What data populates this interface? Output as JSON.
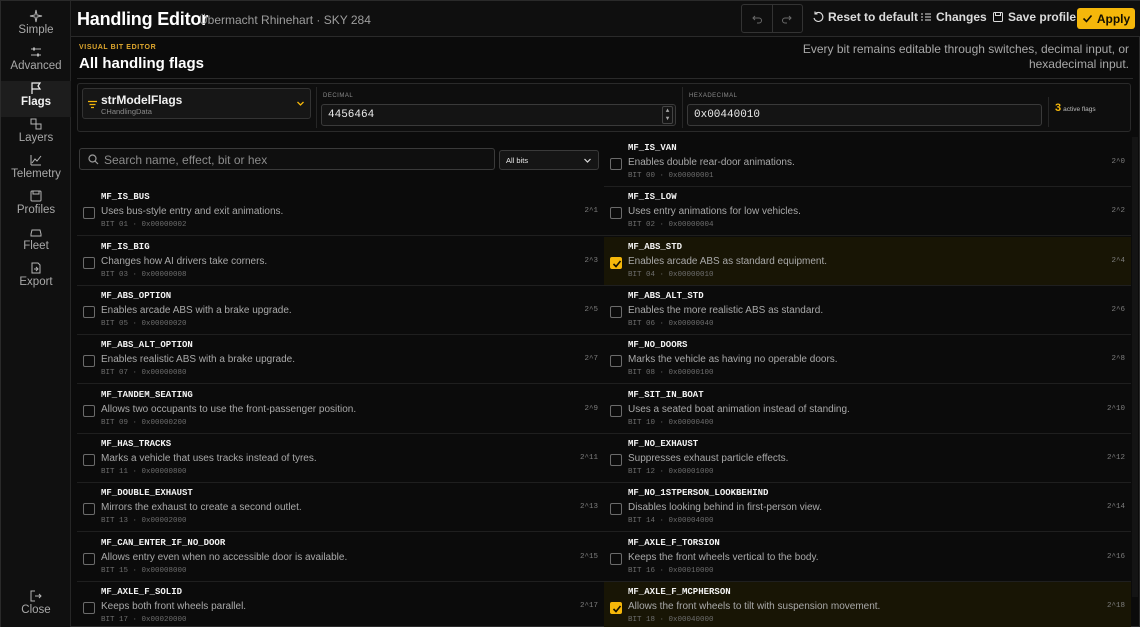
{
  "nav": {
    "items": [
      {
        "label": "Simple",
        "icon": "sparkle-icon"
      },
      {
        "label": "Advanced",
        "icon": "sliders-icon"
      },
      {
        "label": "Flags",
        "icon": "flag-icon"
      },
      {
        "label": "Layers",
        "icon": "layers-icon"
      },
      {
        "label": "Telemetry",
        "icon": "chart-icon"
      },
      {
        "label": "Profiles",
        "icon": "save-icon"
      },
      {
        "label": "Fleet",
        "icon": "car-icon"
      },
      {
        "label": "Export",
        "icon": "export-icon"
      }
    ],
    "active": "Flags",
    "close_label": "Close"
  },
  "header": {
    "title": "Handling Editor",
    "subtitle": "Übermacht Rhinehart · SKY 284",
    "reset_label": "Reset to default",
    "changes_label": "Changes",
    "save_label": "Save profile",
    "apply_label": "Apply"
  },
  "section": {
    "eyebrow": "VISUAL BIT EDITOR",
    "title": "All handling flags",
    "note": "Every bit remains editable through switches, decimal input, or hexadecimal input."
  },
  "controls": {
    "field_name": "strModelFlags",
    "field_class": "CHandlingData",
    "decimal_label": "DECIMAL",
    "decimal_value": "4456464",
    "hex_label": "HEXADECIMAL",
    "hex_value": "0x00440010",
    "active_count": "3",
    "active_label": "active flags"
  },
  "filter": {
    "search_placeholder": "Search name, effect, bit or hex",
    "bits_option": "All bits"
  },
  "flags": [
    {
      "name": "MF_IS_VAN",
      "desc": "Enables double rear-door animations.",
      "bit": "BIT 00 · 0x00000001",
      "pow": "2^0",
      "checked": false
    },
    {
      "name": "MF_IS_BUS",
      "desc": "Uses bus-style entry and exit animations.",
      "bit": "BIT 01 · 0x00000002",
      "pow": "2^1",
      "checked": false
    },
    {
      "name": "MF_IS_LOW",
      "desc": "Uses entry animations for low vehicles.",
      "bit": "BIT 02 · 0x00000004",
      "pow": "2^2",
      "checked": false
    },
    {
      "name": "MF_IS_BIG",
      "desc": "Changes how AI drivers take corners.",
      "bit": "BIT 03 · 0x00000008",
      "pow": "2^3",
      "checked": false
    },
    {
      "name": "MF_ABS_STD",
      "desc": "Enables arcade ABS as standard equipment.",
      "bit": "BIT 04 · 0x00000010",
      "pow": "2^4",
      "checked": true
    },
    {
      "name": "MF_ABS_OPTION",
      "desc": "Enables arcade ABS with a brake upgrade.",
      "bit": "BIT 05 · 0x00000020",
      "pow": "2^5",
      "checked": false
    },
    {
      "name": "MF_ABS_ALT_STD",
      "desc": "Enables the more realistic ABS as standard.",
      "bit": "BIT 06 · 0x00000040",
      "pow": "2^6",
      "checked": false
    },
    {
      "name": "MF_ABS_ALT_OPTION",
      "desc": "Enables realistic ABS with a brake upgrade.",
      "bit": "BIT 07 · 0x00000080",
      "pow": "2^7",
      "checked": false
    },
    {
      "name": "MF_NO_DOORS",
      "desc": "Marks the vehicle as having no operable doors.",
      "bit": "BIT 08 · 0x00000100",
      "pow": "2^8",
      "checked": false
    },
    {
      "name": "MF_TANDEM_SEATING",
      "desc": "Allows two occupants to use the front-passenger position.",
      "bit": "BIT 09 · 0x00000200",
      "pow": "2^9",
      "checked": false
    },
    {
      "name": "MF_SIT_IN_BOAT",
      "desc": "Uses a seated boat animation instead of standing.",
      "bit": "BIT 10 · 0x00000400",
      "pow": "2^10",
      "checked": false
    },
    {
      "name": "MF_HAS_TRACKS",
      "desc": "Marks a vehicle that uses tracks instead of tyres.",
      "bit": "BIT 11 · 0x00000800",
      "pow": "2^11",
      "checked": false
    },
    {
      "name": "MF_NO_EXHAUST",
      "desc": "Suppresses exhaust particle effects.",
      "bit": "BIT 12 · 0x00001000",
      "pow": "2^12",
      "checked": false
    },
    {
      "name": "MF_DOUBLE_EXHAUST",
      "desc": "Mirrors the exhaust to create a second outlet.",
      "bit": "BIT 13 · 0x00002000",
      "pow": "2^13",
      "checked": false
    },
    {
      "name": "MF_NO_1STPERSON_LOOKBEHIND",
      "desc": "Disables looking behind in first-person view.",
      "bit": "BIT 14 · 0x00004000",
      "pow": "2^14",
      "checked": false
    },
    {
      "name": "MF_CAN_ENTER_IF_NO_DOOR",
      "desc": "Allows entry even when no accessible door is available.",
      "bit": "BIT 15 · 0x00008000",
      "pow": "2^15",
      "checked": false
    },
    {
      "name": "MF_AXLE_F_TORSION",
      "desc": "Keeps the front wheels vertical to the body.",
      "bit": "BIT 16 · 0x00010000",
      "pow": "2^16",
      "checked": false
    },
    {
      "name": "MF_AXLE_F_SOLID",
      "desc": "Keeps both front wheels parallel.",
      "bit": "BIT 17 · 0x00020000",
      "pow": "2^17",
      "checked": false
    },
    {
      "name": "MF_AXLE_F_MCPHERSON",
      "desc": "Allows the front wheels to tilt with suspension movement.",
      "bit": "BIT 18 · 0x00040000",
      "pow": "2^18",
      "checked": true
    }
  ],
  "colors": {
    "accent": "#f5b70a",
    "background": "#0b0b0b"
  }
}
